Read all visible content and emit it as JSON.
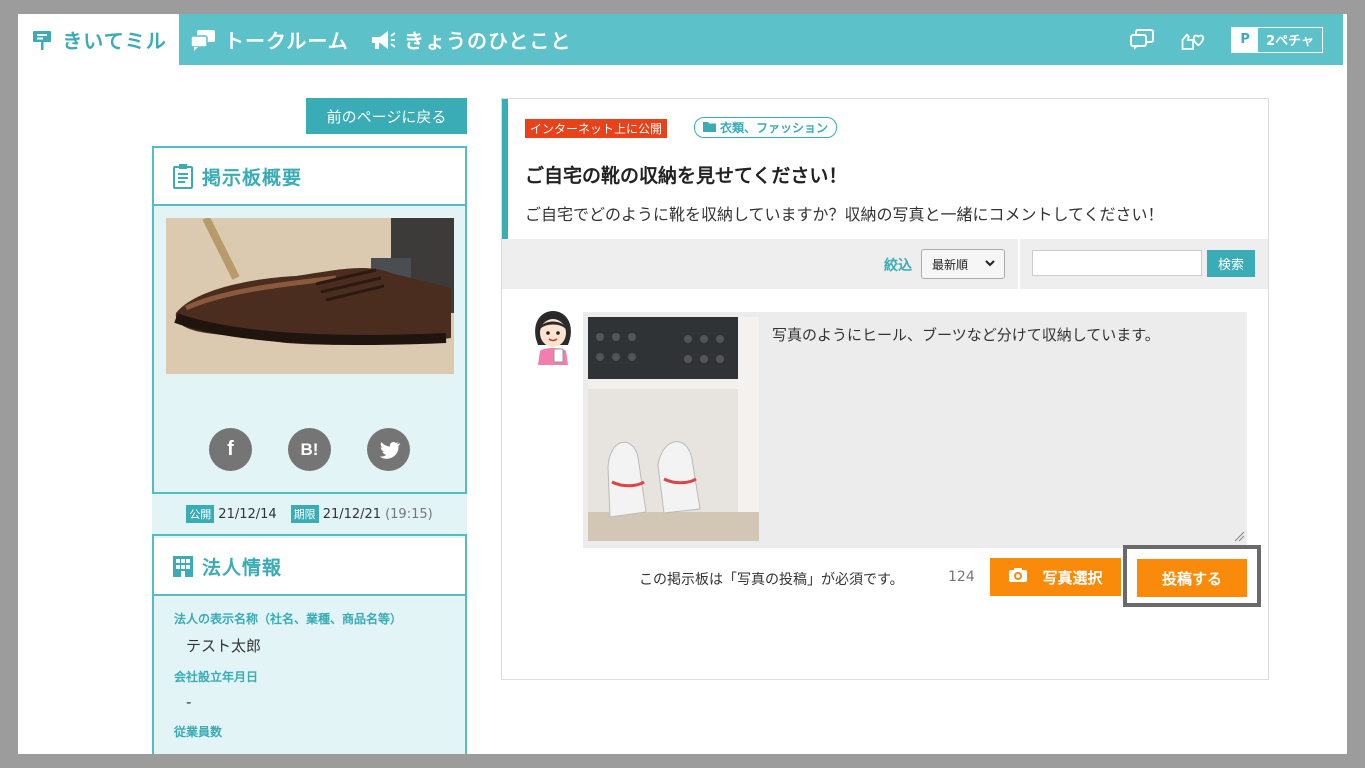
{
  "header": {
    "tabs": [
      {
        "label": "きいてミル",
        "icon": "signboard-icon"
      },
      {
        "label": "トークルーム",
        "icon": "chat-bubbles-icon"
      },
      {
        "label": "きょうのひとこと",
        "icon": "megaphone-icon"
      }
    ],
    "user": {
      "badge": "P",
      "name": "2ペチャ"
    }
  },
  "sidebar": {
    "back_label": "前のページに戻る",
    "overview_title": "掲示板概要",
    "social": [
      "f",
      "B!",
      "twitter"
    ],
    "dates": {
      "publish_tag": "公開",
      "publish_date": "21/12/14",
      "deadline_tag": "期限",
      "deadline_date": "21/12/21",
      "deadline_time": "(19:15)"
    },
    "corp_title": "法人情報",
    "corp_fields": [
      {
        "label": "法人の表示名称（社名、業種、商品名等）",
        "value": "テスト太郎"
      },
      {
        "label": "会社設立年月日",
        "value": "-"
      },
      {
        "label": "従業員数",
        "value": ""
      }
    ]
  },
  "topic": {
    "visibility": "インターネット上に公開",
    "category": "衣類、ファッション",
    "title": "ご自宅の靴の収納を見せてください！",
    "description": "ご自宅でどのように靴を収納していますか？収納の写真と一緒にコメントしてください！"
  },
  "filter": {
    "label": "絞込",
    "sort_selected": "最新順",
    "search_placeholder": "",
    "search_button": "検索"
  },
  "post": {
    "text": "写真のようにヒール、ブーツなど分けて収納しています。",
    "note": "この掲示板は「写真の投稿」が必須です。",
    "remaining_chars": "124",
    "photo_button": "写真選択",
    "submit_button": "投稿する"
  },
  "colors": {
    "brand": "#5cc1c8",
    "accent": "#3aacb6",
    "orange": "#f98a0a",
    "red_badge": "#e8421b"
  }
}
